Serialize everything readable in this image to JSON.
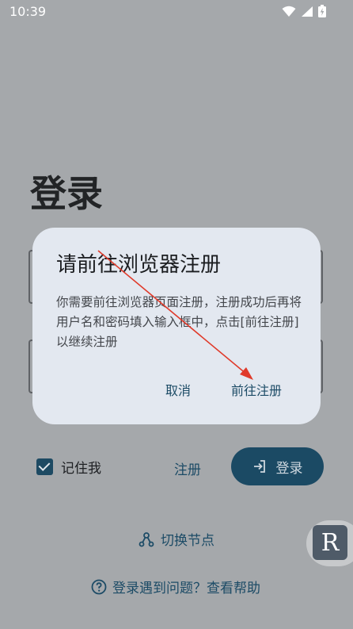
{
  "status_bar": {
    "time": "10:39",
    "icons": [
      "wifi-icon",
      "signal-icon",
      "battery-charging-icon"
    ]
  },
  "page": {
    "title": "登录",
    "remember_me": {
      "label": "记住我",
      "checked": true
    },
    "register_label": "注册",
    "login_button_label": "登录",
    "switch_node_label": "切换节点",
    "help_label": "登录遇到问题？查看帮助"
  },
  "dialog": {
    "title": "请前往浏览器注册",
    "message": "你需要前往浏览器页面注册，注册成功后再将用户名和密码填入输入框中，点击[前往注册]以继续注册",
    "cancel_label": "取消",
    "confirm_label": "前往注册"
  },
  "floating_widget": {
    "letter": "R"
  },
  "colors": {
    "scrim_background": "#a5a8ab",
    "dialog_background": "#e3e8f0",
    "accent": "#1b4a64",
    "annotation_arrow": "#e03a2a"
  }
}
